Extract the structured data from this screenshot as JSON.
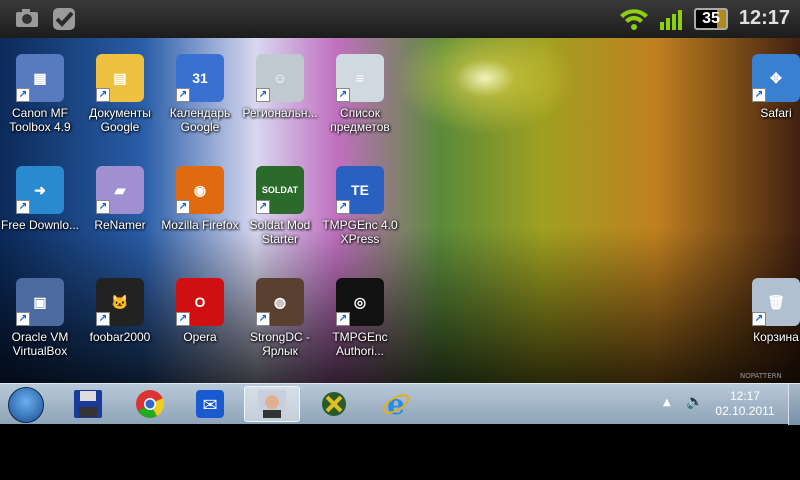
{
  "status_bar": {
    "battery": "35",
    "time": "12:17",
    "icons": [
      "camera-icon",
      "checkmark-icon",
      "wifi-icon",
      "signal-icon",
      "battery-icon"
    ]
  },
  "desktop": {
    "icons": [
      {
        "label": "Canon MF Toolbox 4.9",
        "color": "#5a7ac0",
        "glyph": "▦"
      },
      {
        "label": "Документы Google",
        "color": "#f0c040",
        "glyph": "▤"
      },
      {
        "label": "Календарь Google",
        "color": "#3a70d0",
        "glyph": "31"
      },
      {
        "label": "Региональн...",
        "color": "#c0c8d0",
        "glyph": "☺"
      },
      {
        "label": "Список предметов",
        "color": "#d0d8e0",
        "glyph": "≡"
      },
      {
        "label": "Free Downlo...",
        "color": "#2a8ad0",
        "glyph": "➜"
      },
      {
        "label": "ReNamer",
        "color": "#a090d0",
        "glyph": "▰"
      },
      {
        "label": "Mozilla Firefox",
        "color": "#e06a10",
        "glyph": "◉"
      },
      {
        "label": "Soldat Mod Starter",
        "color": "#2a6a2a",
        "glyph": "SOLDAT"
      },
      {
        "label": "TMPGEnc 4.0 XPress",
        "color": "#2a60c0",
        "glyph": "TE"
      },
      {
        "label": "Oracle VM VirtualBox",
        "color": "#4a6aa0",
        "glyph": "▣"
      },
      {
        "label": "foobar2000",
        "color": "#222",
        "glyph": "🐱"
      },
      {
        "label": "Opera",
        "color": "#d01010",
        "glyph": "O"
      },
      {
        "label": "StrongDC - Ярлык",
        "color": "#5a4030",
        "glyph": "◍"
      },
      {
        "label": "TMPGEnc Authori...",
        "color": "#111",
        "glyph": "◎"
      },
      {
        "label": "Safari",
        "color": "#3a80d0",
        "glyph": "✥"
      },
      {
        "label": "Корзина",
        "color": "#b0c0d0",
        "glyph": "🗑"
      }
    ]
  },
  "taskbar": {
    "items": [
      "start-button",
      "save-icon",
      "chrome-icon",
      "qip-icon",
      "user-icon",
      "app-icon",
      "internet-explorer-icon"
    ],
    "time": "12:17",
    "date": "02.10.2011"
  },
  "watermark": "NOPATTERN"
}
